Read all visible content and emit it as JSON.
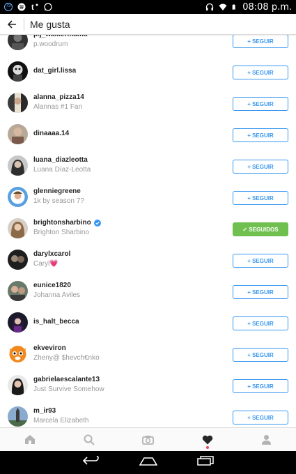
{
  "status_bar": {
    "time": "08:08 p.m.",
    "left_icons": [
      "notification-73-icon",
      "spotify-icon",
      "tumblr-icon",
      "whatsapp-icon"
    ],
    "notification_count": "73",
    "right_icons": [
      "headphones-icon",
      "wifi-icon",
      "battery-icon"
    ]
  },
  "header": {
    "title": "Me gusta",
    "back_icon": "arrow-left-icon"
  },
  "likes": [
    {
      "username": "p.j_walkermama",
      "full_name": "p.woodrum",
      "button": "+ SEGUIR",
      "following": false,
      "verified": false
    },
    {
      "username": "dat_girl.lissa",
      "full_name": "",
      "button": "+ SEGUIR",
      "following": false,
      "verified": false
    },
    {
      "username": "alanna_pizza14",
      "full_name": "Alannas #1 Fan",
      "button": "+ SEGUIR",
      "following": false,
      "verified": false
    },
    {
      "username": "dinaaaa.14",
      "full_name": "",
      "button": "+ SEGUIR",
      "following": false,
      "verified": false
    },
    {
      "username": "luana_diazleotta",
      "full_name": "Luana Díaz-Leotta",
      "button": "+ SEGUIR",
      "following": false,
      "verified": false
    },
    {
      "username": "glenniegreene",
      "full_name": "1k by season 7?",
      "button": "+ SEGUIR",
      "following": false,
      "verified": false
    },
    {
      "username": "brightonsharbino",
      "full_name": "Brighton Sharbino",
      "button": "✓ SEGUIDOS",
      "following": true,
      "verified": true
    },
    {
      "username": "darylxcarol",
      "full_name": "Caryl💗",
      "button": "+ SEGUIR",
      "following": false,
      "verified": false
    },
    {
      "username": "eunice1820",
      "full_name": "Johanna Aviles",
      "button": "+ SEGUIR",
      "following": false,
      "verified": false
    },
    {
      "username": "is_halt_becca",
      "full_name": "",
      "button": "+ SEGUIR",
      "following": false,
      "verified": false
    },
    {
      "username": "ekveviron",
      "full_name": "Zheny@  $hevch€nko",
      "button": "+ SEGUIR",
      "following": false,
      "verified": false
    },
    {
      "username": "gabrielaescalante13",
      "full_name": "Just Survive Somehow",
      "button": "+ SEGUIR",
      "following": false,
      "verified": false
    },
    {
      "username": "m_ir93",
      "full_name": "Marcela Elizabeth",
      "button": "+ SEGUIR",
      "following": false,
      "verified": false
    }
  ],
  "bottom_nav": {
    "items": [
      "home-icon",
      "search-icon",
      "camera-icon",
      "heart-icon",
      "profile-icon"
    ],
    "active": "heart-icon"
  },
  "system_nav": [
    "back-icon",
    "home-icon",
    "recents-icon"
  ],
  "colors": {
    "accent": "#3897f0",
    "following_green": "#70c050",
    "notification_dot": "#ed4956",
    "verified_blue": "#3897f0"
  }
}
